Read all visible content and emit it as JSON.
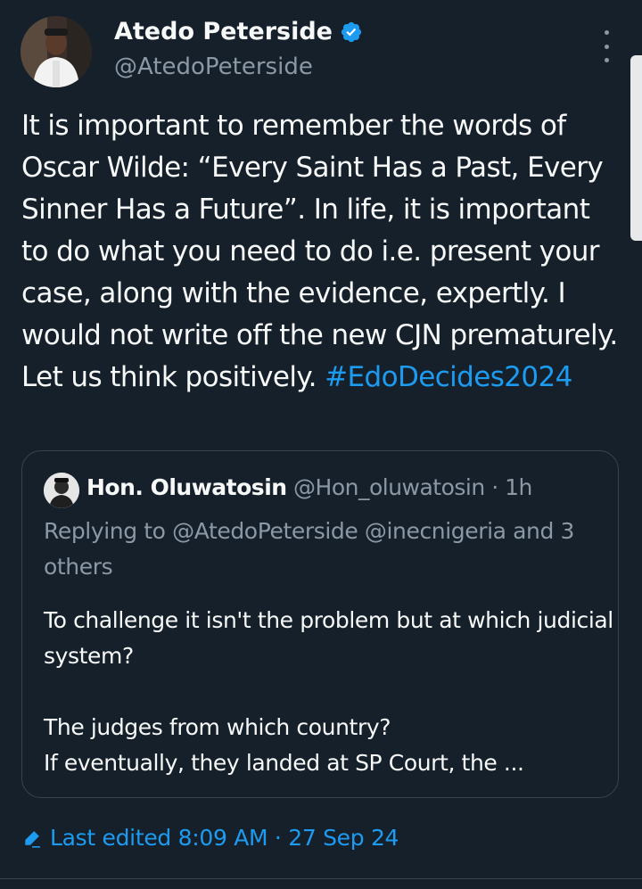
{
  "author": {
    "name": "Atedo Peterside",
    "handle": "@AtedoPeterside",
    "verified": true
  },
  "tweet": {
    "text": "It is important to remember the words of Oscar Wilde: “Every Saint Has a Past, Every Sinner Has a Future”. In life, it is important to do what you need to do i.e. present your case, along with the evidence, expertly. I would not write off the new CJN prematurely. Let us think positively. ",
    "hashtag": "#EdoDecides2024"
  },
  "quote": {
    "name": "Hon. Oluwatosin",
    "handle": "@Hon_oluwatosin",
    "time": "1h",
    "replying_to": "Replying to @AtedoPeterside @inecnigeria and 3 others",
    "lines": [
      "To challenge it isn't the problem but at which judicial system?",
      "The judges from which country?",
      "If eventually, they landed at SP Court, the ..."
    ]
  },
  "edited": {
    "label": "Last edited 8:09 AM · 27 Sep 24"
  },
  "colors": {
    "background": "#15202b",
    "accent": "#1d9bf0",
    "secondary_text": "#8b98a5",
    "border": "#38444d"
  },
  "icons": {
    "verified": "verified-badge-icon",
    "more": "more-options-icon",
    "edit": "edit-pencil-icon"
  }
}
